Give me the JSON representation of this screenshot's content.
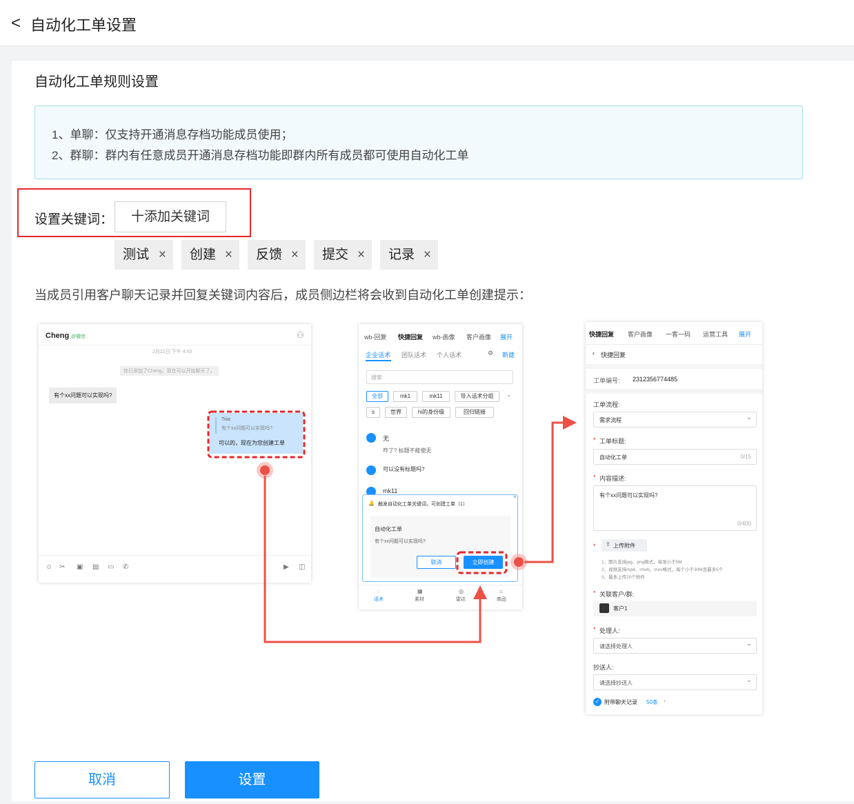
{
  "header": {
    "back_icon": "chevron-left-icon",
    "title": "自动化工单设置"
  },
  "section_title": "自动化工单规则设置",
  "notice": {
    "line1": "1、单聊：仅支持开通消息存档功能成员使用；",
    "line2": "2、群聊：群内有任意成员开通消息存档功能即群内所有成员都可使用自动化工单"
  },
  "keywords": {
    "label": "设置关键词：",
    "add_label": "十添加关键词",
    "tags": [
      "测试",
      "创建",
      "反馈",
      "提交",
      "记录"
    ],
    "remove_glyph": "×"
  },
  "description": "当成员引用客户聊天记录并回复关键词内容后，成员侧边栏将会收到自动化工单创建提示：",
  "chat": {
    "name": "Cheng",
    "wechat": "@微信",
    "date": "2月22日 下午 4:43",
    "system": "你已添加了Cheng，现在可以开始聊天了。",
    "incoming": "有个xx问题可以实现吗?",
    "quote_name": "Tiiia:",
    "quote_text": "有个xx问题可以实现吗?",
    "reply": "可以的，现在为您创建工单"
  },
  "sidebar1": {
    "tabs": [
      "wb-回复",
      "快捷回复",
      "wb-画像",
      "客户画像"
    ],
    "expand": "展开",
    "subtabs": [
      "企业话术",
      "团队话术",
      "个人话术"
    ],
    "new": "新建",
    "search": "搜索",
    "chips_row1": [
      "全部",
      "mk1",
      "mk11",
      "导入话术分组"
    ],
    "chips_row2": [
      "s",
      "世界",
      "hi的身份级",
      "回归链接"
    ],
    "items": [
      {
        "title": "无",
        "sub": "咋了? 标题不能使无"
      },
      {
        "title": "可以没有标题吗?",
        "sub": ""
      },
      {
        "title": "mk11",
        "sub": ""
      }
    ],
    "popup": {
      "title": "触发自动化工单关键词，可创建工单（1）",
      "card_title": "自动化工单",
      "card_text": "有个xx问题可以实现吗?",
      "cancel": "取消",
      "create": "立即创建"
    },
    "nav": [
      "话术",
      "素材",
      "雷达",
      "商品"
    ]
  },
  "sidebar2": {
    "tabs": [
      "快捷回复",
      "客户画像",
      "一客一码",
      "运营工具"
    ],
    "expand": "展开",
    "back": "快捷回复",
    "ticket_no_label": "工单编号:",
    "ticket_no": "2312356774485",
    "flow_label": "工单流程:",
    "flow_value": "需求流程",
    "title_label": "工单标题:",
    "title_value": "自动化工单",
    "title_count": "0/15",
    "content_label": "内容描述:",
    "content_value": "有个xx问题可以实现吗?",
    "content_count": "0/400",
    "upload": "上传附件",
    "hint1": "1、图片支持jpg、png格式，每张小于5M",
    "hint2": "2、视频支持mp4、rmvb、mov格式，每个小于30M且最多5个",
    "hint3": "3、最多上传20个附件",
    "customer_label": "关联客户/群:",
    "customer": "客户1",
    "handler_label": "处理人:",
    "handler_placeholder": "请选择处理人",
    "cc_label": "抄送人:",
    "cc_placeholder": "请选择抄送人",
    "attach": "附带聊天记录",
    "attach_count": "50条"
  },
  "actions": {
    "cancel": "取消",
    "submit": "设置"
  },
  "colors": {
    "primary": "#1890ff",
    "danger": "#e6262b",
    "arrow": "#ec5046"
  }
}
